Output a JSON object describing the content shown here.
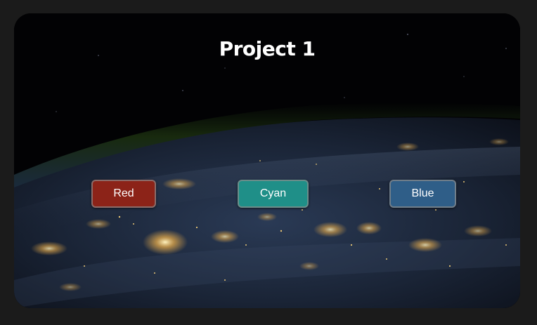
{
  "page": {
    "title": "Project 1"
  },
  "buttons": [
    {
      "label": "Red",
      "color": "#8c2318"
    },
    {
      "label": "Cyan",
      "color": "#1f8f88"
    },
    {
      "label": "Blue",
      "color": "#2f5e88"
    }
  ],
  "background": {
    "image": "earth-at-night-from-space"
  }
}
